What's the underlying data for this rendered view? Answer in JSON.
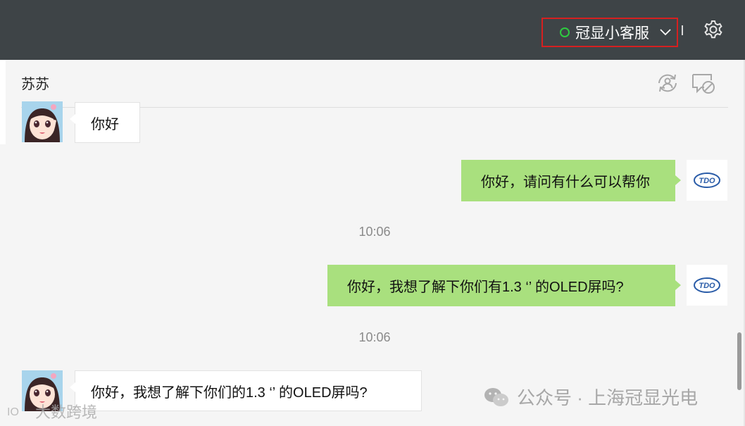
{
  "topbar": {
    "account_name": "冠显小客服",
    "status_color": "#2ecc40",
    "highlight_color": "#d62020",
    "settings_icon": "gear-icon"
  },
  "chat": {
    "contact_name": "苏苏",
    "header_icons": [
      "transfer-user-icon",
      "block-chat-icon"
    ],
    "messages": [
      {
        "side": "in",
        "text": "你好"
      },
      {
        "side": "out",
        "text": "你好，请问有什么可以帮你"
      },
      {
        "side": "time",
        "text": "10:06"
      },
      {
        "side": "out",
        "text": "你好，我想了解下你们有1.3 ‘’ 的OLED屏吗?"
      },
      {
        "side": "time",
        "text": "10:06"
      },
      {
        "side": "in",
        "text": "你好，我想了解下你们的1.3 ‘’ 的OLED屏吗?"
      }
    ],
    "agent_avatar_text": "TDO"
  },
  "watermarks": {
    "wechat": "公众号 · 上海冠显光电",
    "corner": "大数跨境"
  }
}
